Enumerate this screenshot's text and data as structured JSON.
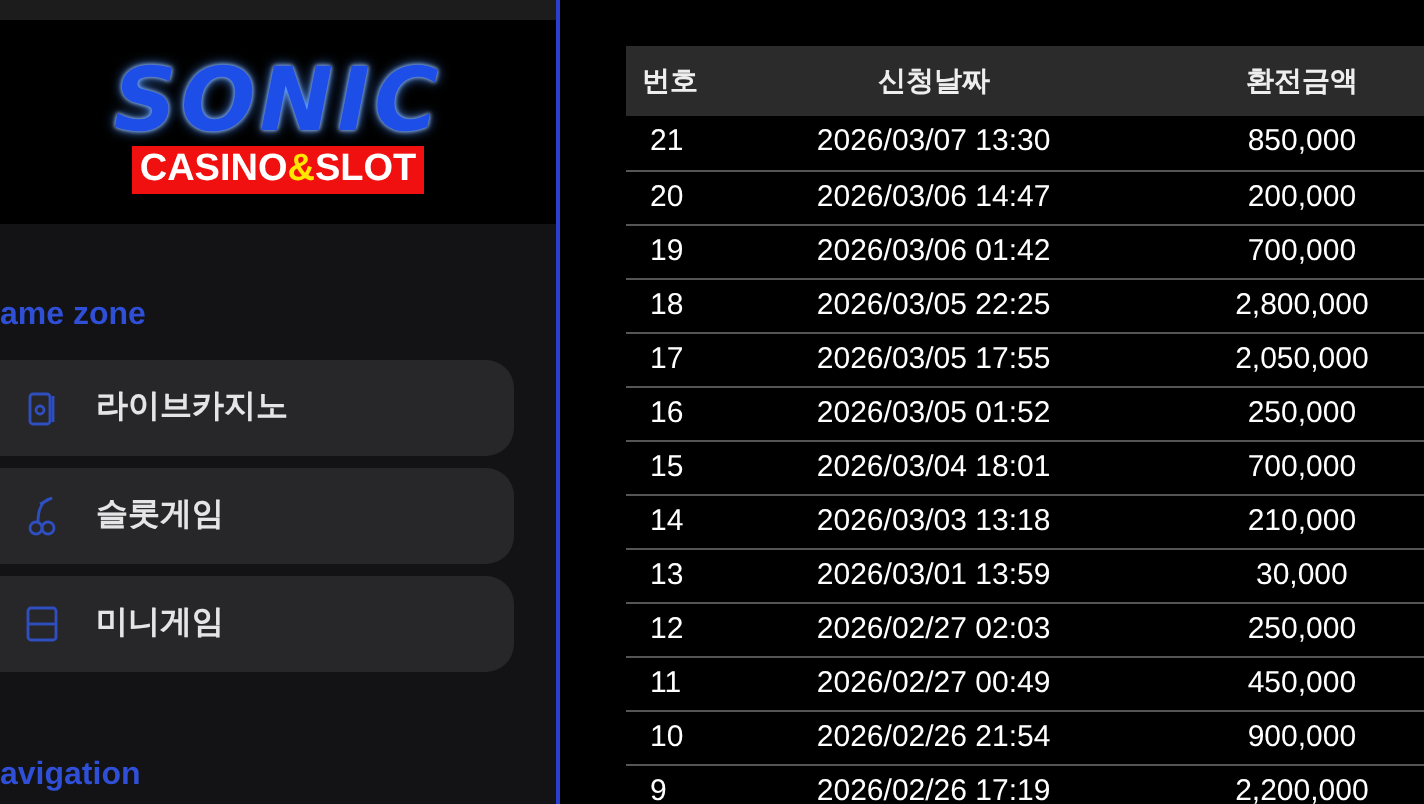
{
  "logo": {
    "title": "SONIC",
    "subtitle": {
      "before": "CASINO",
      "accent": "&",
      "after": "SLOT"
    }
  },
  "sections": [
    {
      "heading": "ame zone",
      "items": [
        {
          "label": "라이브카지노"
        },
        {
          "label": "슬롯게임"
        },
        {
          "label": "미니게임"
        }
      ]
    },
    {
      "heading": "avigation"
    }
  ],
  "table": {
    "columns": [
      "번호",
      "신청날짜",
      "환전금액"
    ],
    "rows": [
      [
        "21",
        "2026/03/07 13:30",
        "850,000"
      ],
      [
        "20",
        "2026/03/06 14:47",
        "200,000"
      ],
      [
        "19",
        "2026/03/06 01:42",
        "700,000"
      ],
      [
        "18",
        "2026/03/05 22:25",
        "2,800,000"
      ],
      [
        "17",
        "2026/03/05 17:55",
        "2,050,000"
      ],
      [
        "16",
        "2026/03/05 01:52",
        "250,000"
      ],
      [
        "15",
        "2026/03/04 18:01",
        "700,000"
      ],
      [
        "14",
        "2026/03/03 13:18",
        "210,000"
      ],
      [
        "13",
        "2026/03/01 13:59",
        "30,000"
      ],
      [
        "12",
        "2026/02/27 02:03",
        "250,000"
      ],
      [
        "11",
        "2026/02/27 00:49",
        "450,000"
      ],
      [
        "10",
        "2026/02/26 21:54",
        "900,000"
      ],
      [
        "9",
        "2026/02/26 17:19",
        "2,200,000"
      ]
    ]
  }
}
